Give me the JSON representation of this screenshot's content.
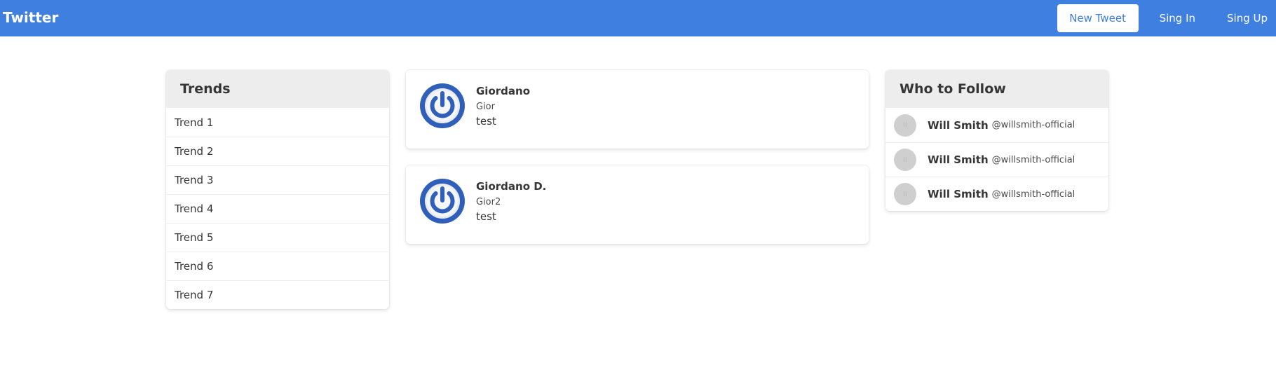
{
  "navbar": {
    "brand": "Twitter",
    "new_tweet_label": "New Tweet",
    "sign_in_label": "Sing In",
    "sign_up_label": "Sing Up",
    "bg_color": "#3f7fe0"
  },
  "trends": {
    "title": "Trends",
    "items": [
      "Trend 1",
      "Trend 2",
      "Trend 3",
      "Trend 4",
      "Trend 5",
      "Trend 6",
      "Trend 7"
    ]
  },
  "tweets": [
    {
      "name": "Giordano",
      "handle": "Gior",
      "text": "test",
      "avatar_icon": "power-icon"
    },
    {
      "name": "Giordano D.",
      "handle": "Gior2",
      "text": "test",
      "avatar_icon": "power-icon"
    }
  ],
  "who_to_follow": {
    "title": "Who to Follow",
    "items": [
      {
        "name": "Will Smith",
        "handle": "@willsmith-official"
      },
      {
        "name": "Will Smith",
        "handle": "@willsmith-official"
      },
      {
        "name": "Will Smith",
        "handle": "@willsmith-official"
      }
    ]
  }
}
